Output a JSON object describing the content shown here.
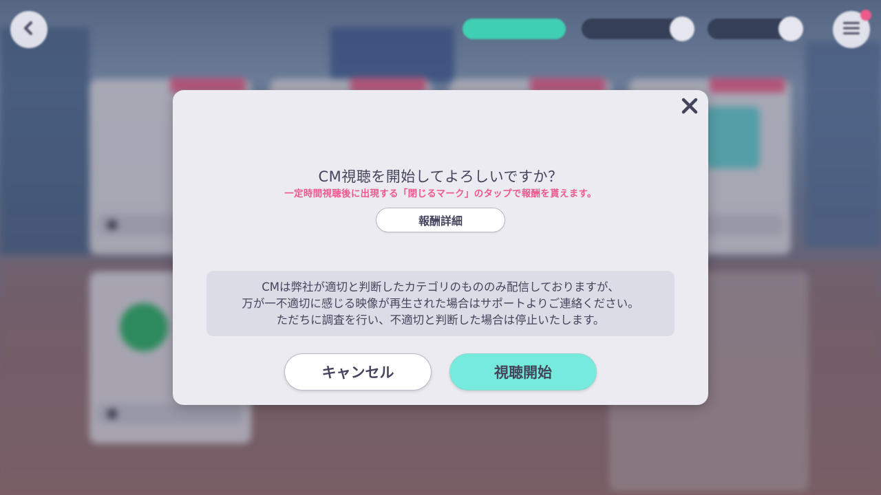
{
  "dialog": {
    "title": "CM視聴を開始してよろしいですか？",
    "subtitle": "一定時間視聴後に出現する「閉じるマーク」のタップで報酬を貰えます。",
    "detail_button": "報酬詳細",
    "notice_lines": [
      "CMは弊社が適切と判断したカテゴリのもののみ配信しておりますが、",
      "万が一不適切に感じる映像が再生された場合はサポートよりご連絡ください。",
      "ただちに調査を行い、不適切と判断した場合は停止いたします。"
    ],
    "cancel_button": "キャンセル",
    "start_button": "視聴開始"
  },
  "icons": {
    "close": "close-icon",
    "back": "back-arrow-icon",
    "menu": "menu-icon"
  },
  "colors": {
    "dialog_bg": "#ebebf1",
    "accent_pink": "#ee5a8e",
    "start_button": "#76eadc",
    "text": "#44445c"
  }
}
